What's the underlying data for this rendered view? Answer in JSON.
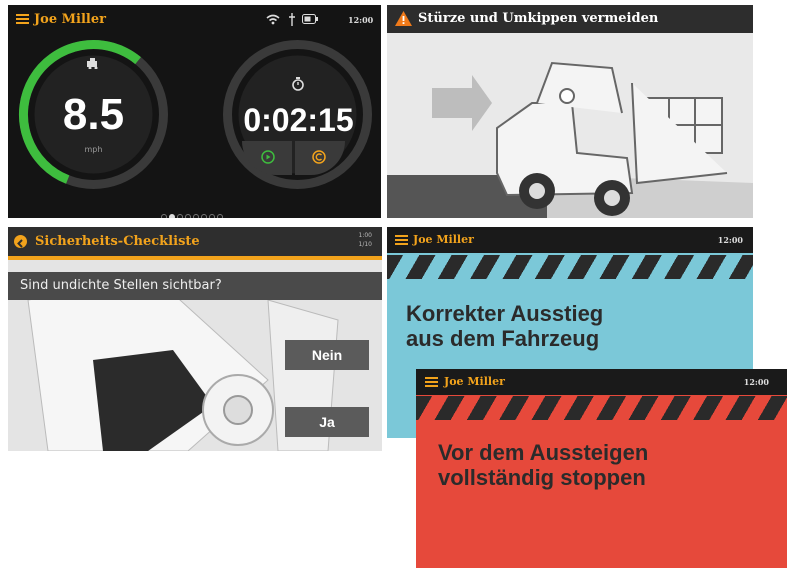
{
  "dashboard": {
    "user_name": "Joe Miller",
    "time": "12:00",
    "speed_value": "8.5",
    "speed_unit": "mph",
    "timer_value": "0:02:15",
    "speed_level": 0.55,
    "page_dots": 8,
    "active_dot": 1,
    "accent_color": "#f2a31c",
    "gauge_color": "#3ebd3e",
    "icons": [
      "menu-icon",
      "wifi-icon",
      "plug-icon",
      "battery-icon",
      "truck-icon",
      "stopwatch-icon",
      "play-icon",
      "pause-icon"
    ]
  },
  "warning_card": {
    "title": "Stürze und Umkippen vermeiden",
    "icon": "warning-icon"
  },
  "checklist": {
    "title": "Sicherheits-Checkliste",
    "progress_top": "1:00",
    "progress_bottom": "1/10",
    "question": "Sind undichte Stellen sichtbar?",
    "no_label": "Nein",
    "yes_label": "Ja",
    "icon": "back-arrow-icon"
  },
  "hazard_exit": {
    "user_name": "Joe Miller",
    "time": "12:00",
    "title_line1": "Korrekter Ausstieg",
    "title_line2": "aus dem Fahrzeug",
    "color": "#7bc8d8"
  },
  "hazard_stop": {
    "user_name": "Joe Miller",
    "time": "12:00",
    "title_line1": "Vor dem Aussteigen",
    "title_line2": "vollständig stoppen",
    "color": "#e6493b"
  }
}
